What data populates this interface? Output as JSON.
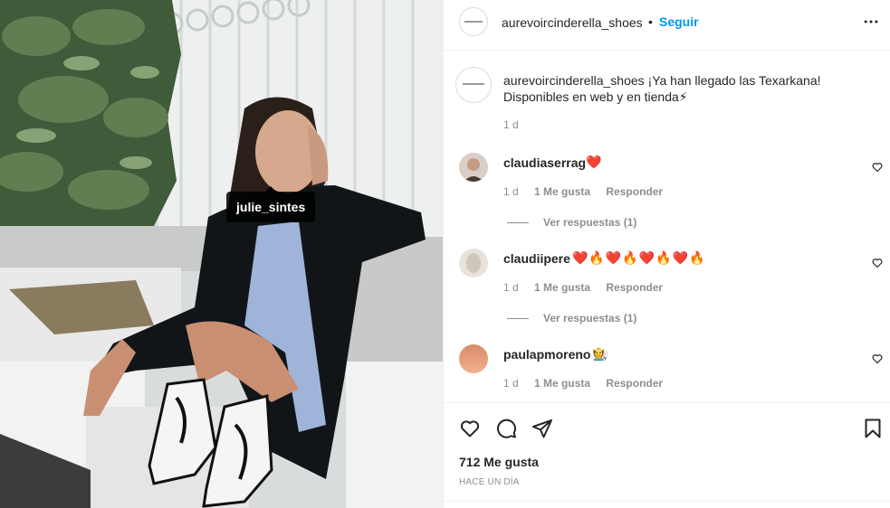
{
  "post": {
    "photo_tag": "julie_sintes",
    "header": {
      "username": "aurevoircinderella_shoes",
      "separator": "•",
      "follow_label": "Seguir",
      "more_icon": "more-horizontal-icon"
    },
    "caption": {
      "username": "aurevoircinderella_shoes",
      "text": "¡Ya han llegado las Texarkana! Disponibles en web y en tienda⚡",
      "time": "1 d"
    },
    "comments": [
      {
        "username": "claudiaserrag",
        "text": "❤️",
        "time": "1 d",
        "likes": "1 Me gusta",
        "reply": "Responder",
        "view_replies": "Ver respuestas (1)"
      },
      {
        "username": "claudiipere",
        "text": "❤️🔥❤️🔥❤️🔥❤️🔥",
        "time": "1 d",
        "likes": "1 Me gusta",
        "reply": "Responder",
        "view_replies": "Ver respuestas (1)"
      },
      {
        "username": "paulapmoreno",
        "text": "🧑‍🌾",
        "time": "1 d",
        "likes": "1 Me gusta",
        "reply": "Responder"
      }
    ],
    "actions": {
      "like_icon": "heart-icon",
      "comment_icon": "comment-icon",
      "share_icon": "send-icon",
      "save_icon": "bookmark-icon"
    },
    "likes_count": "712 Me gusta",
    "posted": "HACE UN DÍA",
    "colors": {
      "link": "#0095f6",
      "muted": "#8e8e8e",
      "text": "#262626",
      "border": "#efefef",
      "heart": "#ed4956"
    }
  }
}
